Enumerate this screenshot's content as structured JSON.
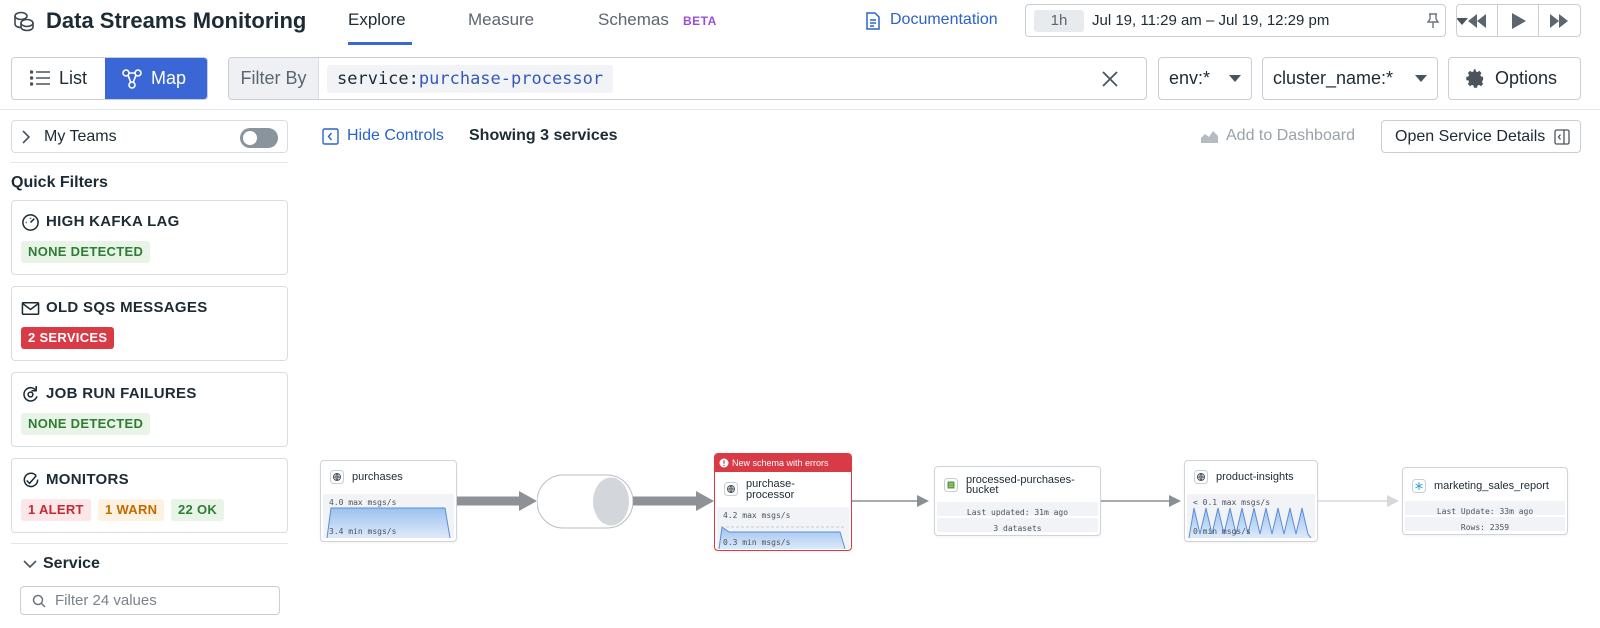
{
  "app": {
    "title": "Data Streams Monitoring"
  },
  "nav": {
    "tabs": [
      {
        "label": "Explore",
        "active": true
      },
      {
        "label": "Measure",
        "active": false
      },
      {
        "label": "Schemas",
        "active": false,
        "badge": "BETA"
      }
    ],
    "documentation": "Documentation"
  },
  "time": {
    "preset": "1h",
    "range": "Jul 19, 11:29 am – Jul 19, 12:29 pm"
  },
  "toolbar": {
    "list_label": "List",
    "map_label": "Map",
    "filter_label": "Filter By",
    "filter_key": "service:",
    "filter_value": "purchase-processor",
    "env": "env:*",
    "cluster": "cluster_name:*",
    "options": "Options"
  },
  "sidebar": {
    "my_teams": "My Teams",
    "quick_filters_title": "Quick Filters",
    "quick_filters": [
      {
        "name": "HIGH KAFKA LAG",
        "icon": "gauge-icon",
        "badges": [
          {
            "label": "NONE DETECTED",
            "color": "#2e7d32"
          }
        ]
      },
      {
        "name": "OLD SQS MESSAGES",
        "icon": "envelope-icon",
        "badges": [
          {
            "label": "2 SERVICES",
            "color": "#d83a46"
          }
        ]
      },
      {
        "name": "JOB RUN FAILURES",
        "icon": "refresh-icon",
        "badges": [
          {
            "label": "NONE DETECTED",
            "color": "#2e7d32"
          }
        ]
      },
      {
        "name": "MONITORS",
        "icon": "monitor-icon",
        "badges": [
          {
            "label": "1 ALERT",
            "color": "#c22a36"
          },
          {
            "label": "1 WARN",
            "color": "#c26a00"
          },
          {
            "label": "22 OK",
            "color": "#2e7d32"
          }
        ]
      }
    ],
    "service_header": "Service",
    "service_filter_placeholder": "Filter 24 values"
  },
  "main": {
    "hide_controls": "Hide Controls",
    "showing": "Showing 3 services",
    "add_to_dashboard": "Add to Dashboard",
    "open_service_details": "Open Service Details"
  },
  "map": {
    "nodes": {
      "purchases": {
        "name": "purchases",
        "max": "4.0 max msgs/s",
        "min": "3.4 min msgs/s"
      },
      "purchase_processor": {
        "banner": "New schema with errors",
        "name_line1": "purchase-",
        "name_line2": "processor",
        "max": "4.2 max msgs/s",
        "min": "0.3 min msgs/s"
      },
      "bucket": {
        "name_line1": "processed-purchases-",
        "name_line2": "bucket",
        "last_updated": "Last updated: 31m ago",
        "datasets": "3 datasets"
      },
      "product_insights": {
        "name": "product-insights",
        "max": "< 0.1 max msgs/s",
        "min": "0 min msgs/s"
      },
      "marketing": {
        "name": "marketing_sales_report",
        "last_update": "Last Update: 33m ago",
        "rows": "Rows: 2359"
      }
    }
  },
  "colors": {
    "accent": "#3b67d6",
    "link": "#2a63c9",
    "error": "#d83a46",
    "beta": "#9a4ed6"
  }
}
